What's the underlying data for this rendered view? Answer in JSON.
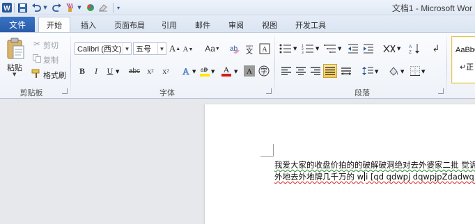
{
  "titlebar": {
    "title": "文档1 - Microsoft Wor"
  },
  "tabs": {
    "file": "文件",
    "home": "开始",
    "insert": "插入",
    "page_layout": "页面布局",
    "references": "引用",
    "mailings": "邮件",
    "review": "审阅",
    "view": "视图",
    "developer": "开发工具"
  },
  "clipboard": {
    "paste": "粘贴",
    "cut": "剪切",
    "copy": "复制",
    "format_painter": "格式刷",
    "group_label": "剪贴板"
  },
  "font": {
    "font_name": "Calibri (西文)",
    "font_size": "五号",
    "group_label": "字体"
  },
  "paragraph": {
    "group_label": "段落"
  },
  "styles": {
    "preview": "AaBbC",
    "name": "↵正"
  },
  "document": {
    "line1": "我爱大家的收盘价拍的的破解破洞绝对去外婆家二批 觉诉",
    "line2_part1": "外地去外地牌几千万的 w",
    "line2_part2": "i [qd qdwpj dqwpjpZdadwqln 我"
  },
  "colors": {
    "accent": "#2b579a",
    "file_tab": "#2a5caa",
    "highlight": "#ffe600",
    "font_color": "#d01e1e"
  }
}
